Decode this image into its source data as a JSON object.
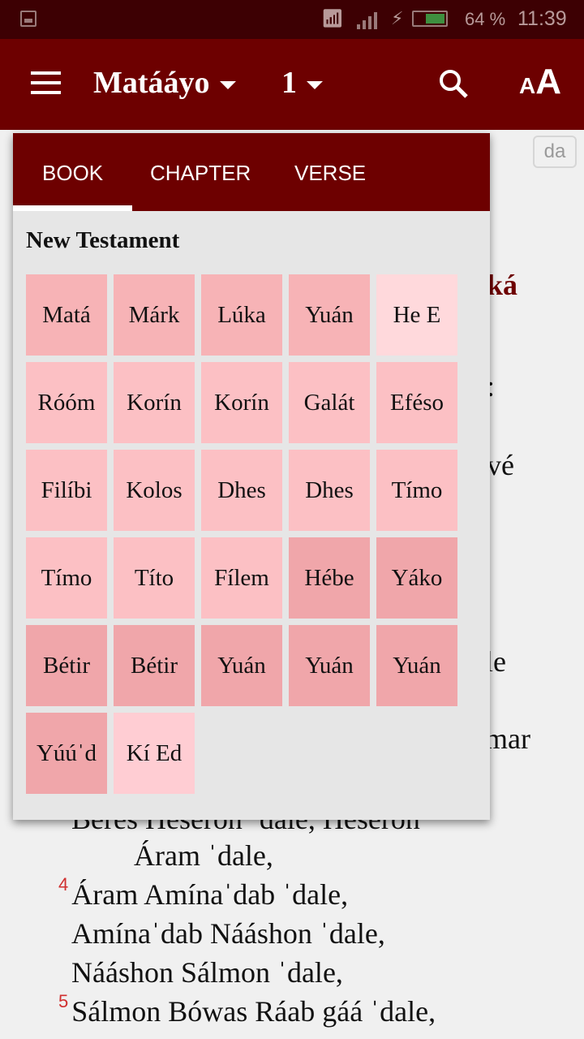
{
  "status_bar": {
    "battery_percent": "64 %",
    "battery_level": 0.64,
    "time": "11:39",
    "icons": [
      "image-icon",
      "wifi-icon",
      "signal-icon",
      "charging-icon",
      "battery-icon"
    ]
  },
  "app_bar": {
    "book": "Matááyo",
    "chapter": "1",
    "icons": [
      "menu-icon",
      "search-icon",
      "text-size-icon"
    ]
  },
  "language_badge": "da",
  "background_text": {
    "fragments": [
      "ká",
      ":",
      "vé",
      "le",
      "mar"
    ],
    "lines": [
      {
        "num": "",
        "text": "Beres Heseron ˈdale, Heseron"
      },
      {
        "num": "",
        "text": "Áram ˈdale,"
      },
      {
        "num": "4",
        "text": "Áram Amínaˈdab ˈdale,"
      },
      {
        "num": "",
        "text": "Amínaˈdab Nááshon ˈdale,"
      },
      {
        "num": "",
        "text": "Nááshon Sálmon ˈdale,"
      },
      {
        "num": "5",
        "text": "Sálmon Bówas Ráab gáá ˈdale,"
      }
    ]
  },
  "picker": {
    "tabs": [
      {
        "label": "BOOK",
        "active": true
      },
      {
        "label": "CHAPTER",
        "active": false
      },
      {
        "label": "VERSE",
        "active": false
      }
    ],
    "section_title": "New Testament",
    "colors": {
      "gospels": "#f7b3b6",
      "acts": "#ffd9dc",
      "pauline": "#fcc0c4",
      "general": "#f0a6aa",
      "revelation": "#ffcdd3",
      "accent": "#6d0000"
    },
    "books": [
      {
        "label": "Matá",
        "group": "gospels"
      },
      {
        "label": "Márk",
        "group": "gospels"
      },
      {
        "label": "Lúka",
        "group": "gospels"
      },
      {
        "label": "Yuán",
        "group": "gospels"
      },
      {
        "label": "He E",
        "group": "acts"
      },
      {
        "label": "Róóm",
        "group": "pauline"
      },
      {
        "label": "Korín",
        "group": "pauline"
      },
      {
        "label": "Korín",
        "group": "pauline"
      },
      {
        "label": "Galát",
        "group": "pauline"
      },
      {
        "label": "Eféso",
        "group": "pauline"
      },
      {
        "label": "Filíbi",
        "group": "pauline"
      },
      {
        "label": "Kolos",
        "group": "pauline"
      },
      {
        "label": "Dhes",
        "group": "pauline"
      },
      {
        "label": "Dhes",
        "group": "pauline"
      },
      {
        "label": "Tímo",
        "group": "pauline"
      },
      {
        "label": "Tímo",
        "group": "pauline"
      },
      {
        "label": "Títo",
        "group": "pauline"
      },
      {
        "label": "Fílem",
        "group": "pauline"
      },
      {
        "label": "Hébe",
        "group": "general"
      },
      {
        "label": "Yáko",
        "group": "general"
      },
      {
        "label": "Bétir",
        "group": "general"
      },
      {
        "label": "Bétir",
        "group": "general"
      },
      {
        "label": "Yuán",
        "group": "general"
      },
      {
        "label": "Yuán",
        "group": "general"
      },
      {
        "label": "Yuán",
        "group": "general"
      },
      {
        "label": "Yúúˈd",
        "group": "general"
      },
      {
        "label": "Kí Ed",
        "group": "revelation"
      }
    ]
  }
}
